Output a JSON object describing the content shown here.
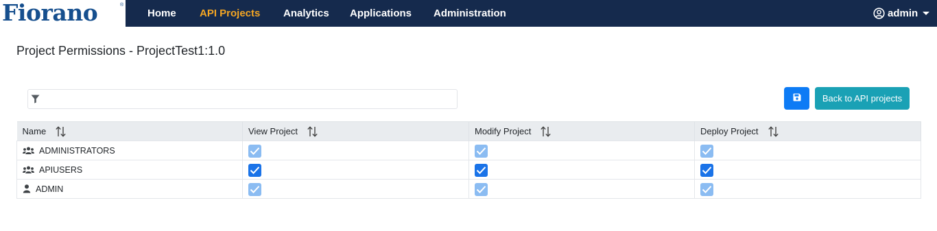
{
  "brand": {
    "logo_text": "Fiorano",
    "logo_mark": "®"
  },
  "nav": {
    "items": [
      {
        "label": "Home",
        "active": false
      },
      {
        "label": "API Projects",
        "active": true
      },
      {
        "label": "Analytics",
        "active": false
      },
      {
        "label": "Applications",
        "active": false
      },
      {
        "label": "Administration",
        "active": false
      }
    ],
    "user": {
      "name": "admin",
      "icon": "user-circle-icon"
    }
  },
  "page": {
    "title": "Project Permissions - ProjectTest1:1.0"
  },
  "filter": {
    "value": "",
    "placeholder": "",
    "icon": "filter-icon"
  },
  "actions": {
    "save_icon": "floppy-disk-icon",
    "back_label": "Back to API projects"
  },
  "table": {
    "columns": [
      "Name",
      "View Project",
      "Modify Project",
      "Deploy Project"
    ],
    "rows": [
      {
        "name": "ADMINISTRATORS",
        "type": "group",
        "view": true,
        "modify": true,
        "deploy": true,
        "editable": false
      },
      {
        "name": "APIUSERS",
        "type": "group",
        "view": true,
        "modify": true,
        "deploy": true,
        "editable": true
      },
      {
        "name": "ADMIN",
        "type": "user",
        "view": true,
        "modify": true,
        "deploy": true,
        "editable": false
      }
    ]
  },
  "colors": {
    "navbar": "#152a4d",
    "logo": "#164f8e",
    "nav_active": "#f5a623",
    "save_button": "#0d7bf5",
    "back_button": "#1aa1b5",
    "checkbox_checked": "#1a73e8",
    "checkbox_disabled": "#8bbcf2"
  }
}
